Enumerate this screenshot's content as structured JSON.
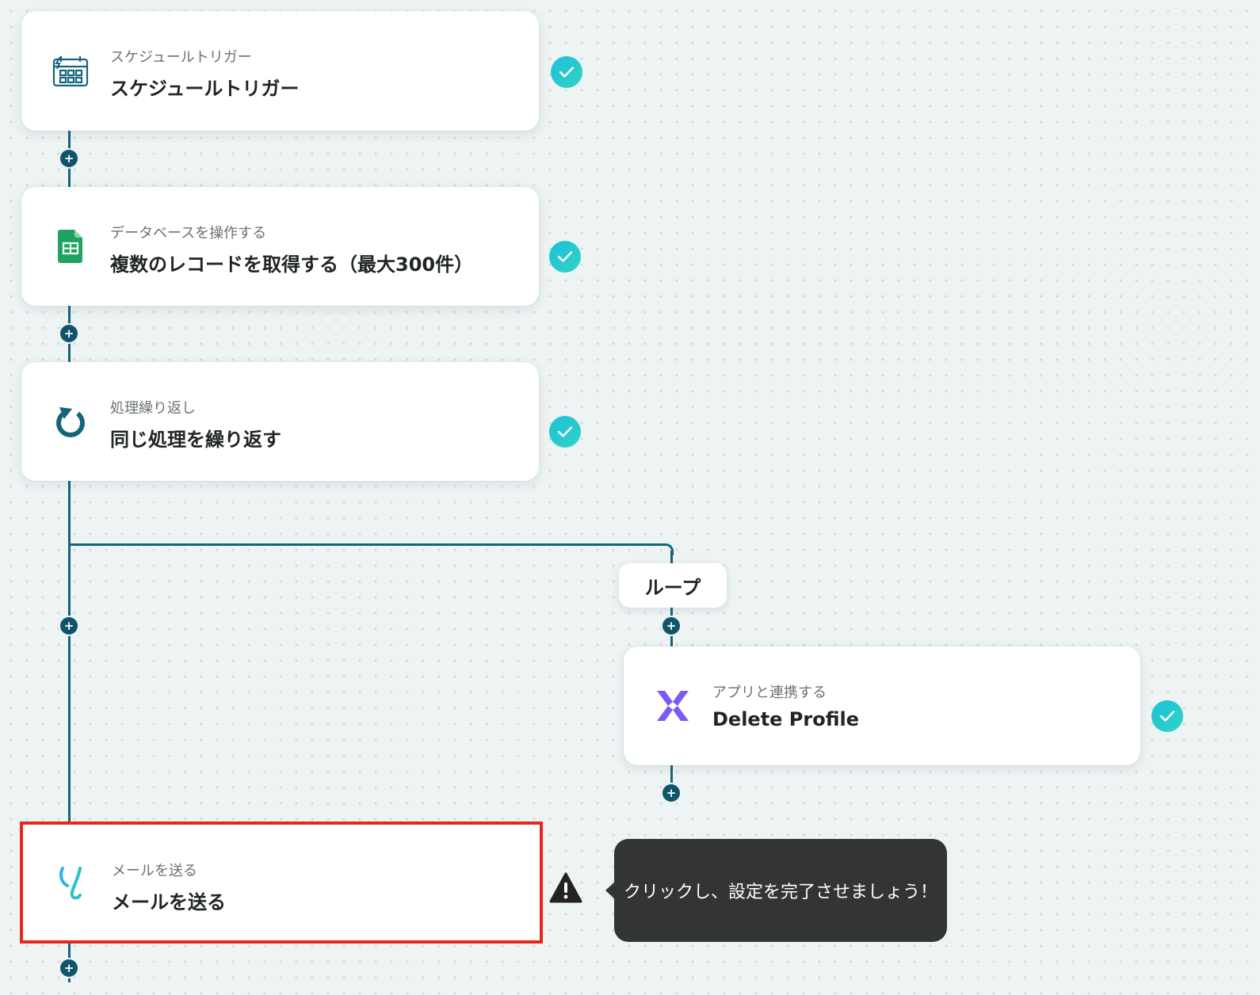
{
  "steps": [
    {
      "subtitle": "スケジュールトリガー",
      "title": "スケジュールトリガー",
      "icon": "calendar-bolt-icon",
      "status": "complete"
    },
    {
      "subtitle": "データベースを操作する",
      "title": "複数のレコードを取得する（最大300件）",
      "icon": "google-sheets-icon",
      "status": "complete"
    },
    {
      "subtitle": "処理繰り返し",
      "title": "同じ処理を繰り返す",
      "icon": "loop-arrow-icon",
      "status": "complete"
    },
    {
      "subtitle": "アプリと連携する",
      "title": "Delete Profile",
      "icon": "app-x-logo-icon",
      "status": "complete"
    },
    {
      "subtitle": "メールを送る",
      "title": "メールを送る",
      "icon": "mail-y-logo-icon",
      "status": "warning"
    }
  ],
  "loop_label": "ループ",
  "tooltip": "クリックし、設定を完了させましょう！",
  "add_button_glyph": "+",
  "colors": {
    "connector": "#14657a",
    "check": "#22c7d3",
    "selected_border": "#e8261b",
    "tooltip_bg": "#333434"
  }
}
